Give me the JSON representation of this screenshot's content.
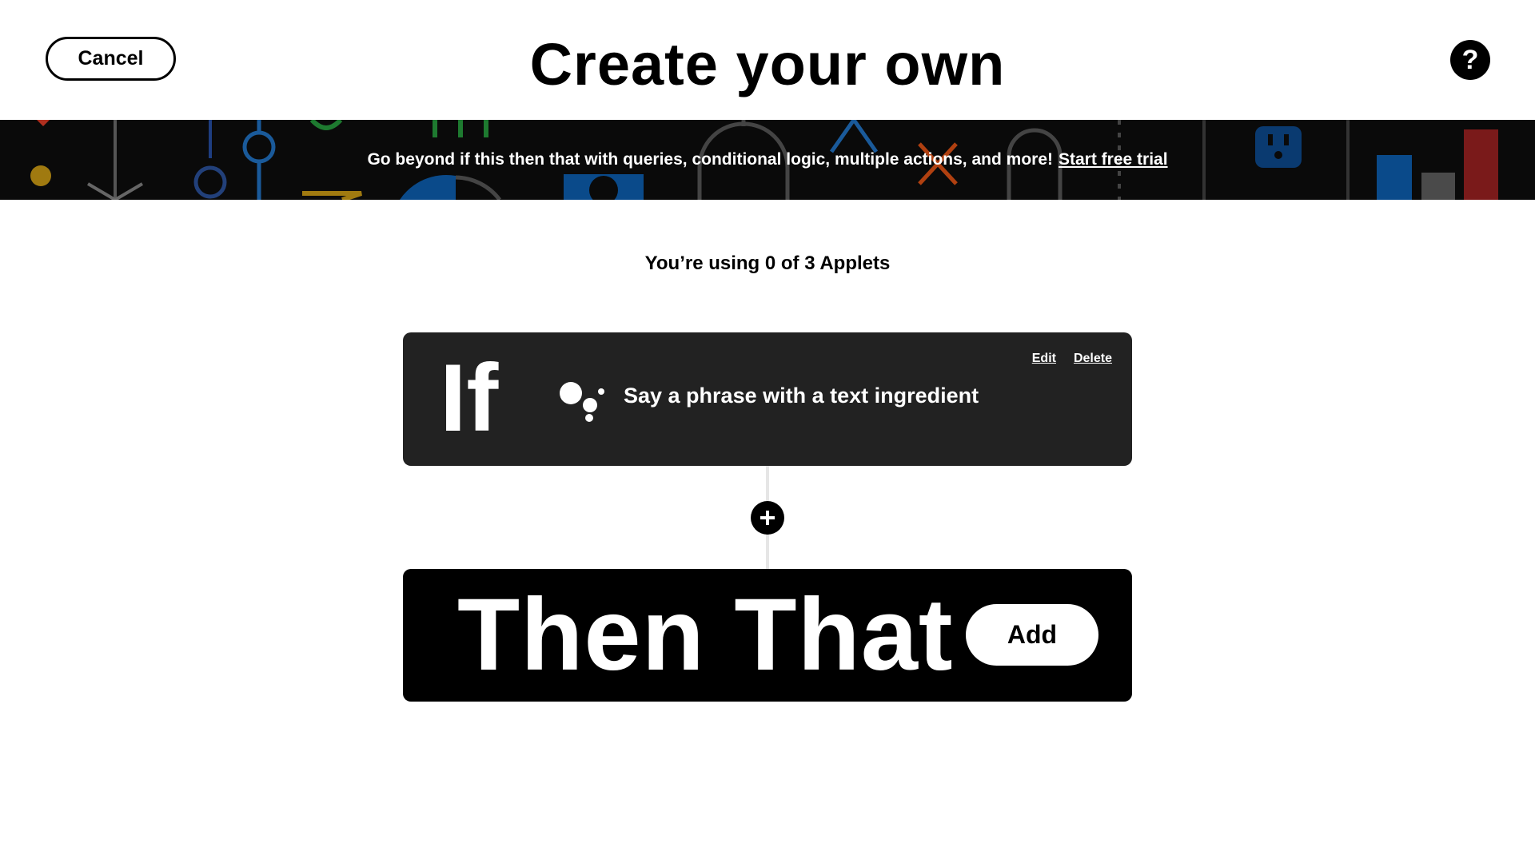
{
  "header": {
    "cancel_label": "Cancel",
    "title": "Create your own",
    "help_label": "?"
  },
  "banner": {
    "text": "Go beyond if this then that with queries, conditional logic, multiple actions, and more!",
    "link_label": "Start free trial"
  },
  "usage": {
    "text": "You’re using 0 of 3 Applets"
  },
  "trigger_card": {
    "label": "If",
    "trigger_text": "Say a phrase with a text ingredient",
    "service_icon": "google-assistant-icon",
    "edit_label": "Edit",
    "delete_label": "Delete"
  },
  "action_card": {
    "label": "Then That",
    "add_label": "Add"
  },
  "colors": {
    "trigger_card_bg": "#222222",
    "action_card_bg": "#000000",
    "banner_bg": "#0a0a0a",
    "connector": "#e6e6e6"
  }
}
